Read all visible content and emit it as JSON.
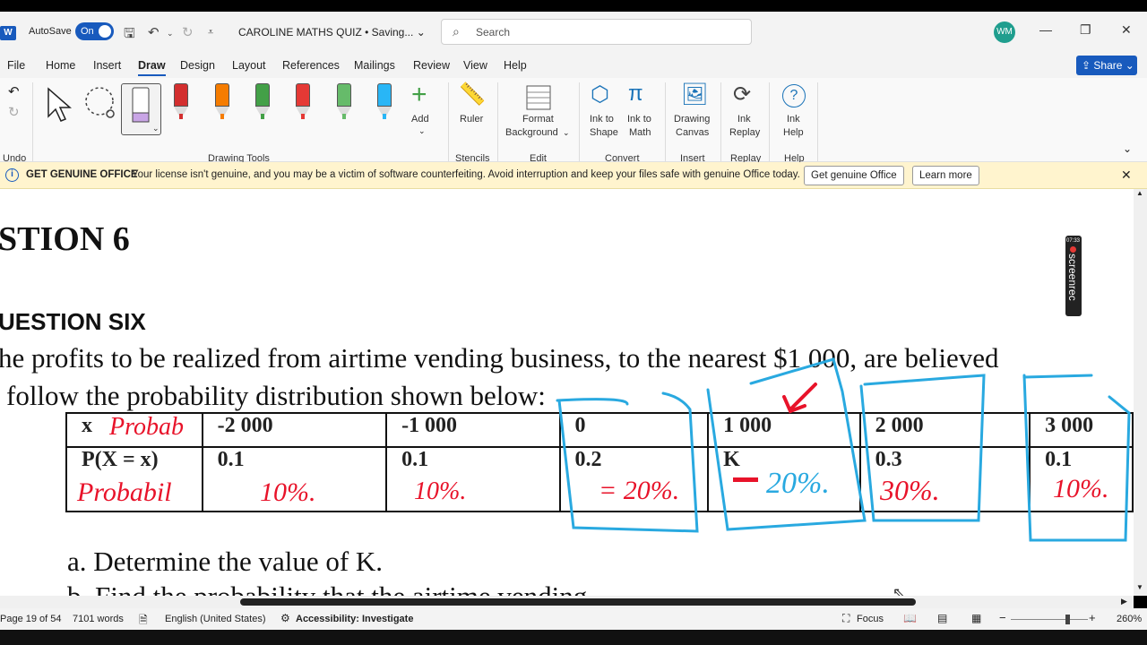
{
  "titlebar": {
    "app_icon": "W",
    "autosave_label": "AutoSave",
    "autosave_state": "On",
    "doc_title": "CAROLINE MATHS QUIZ • Saving...",
    "search_placeholder": "Search",
    "avatar_initials": "WM"
  },
  "menu": {
    "items": [
      "File",
      "Home",
      "Insert",
      "Draw",
      "Design",
      "Layout",
      "References",
      "Mailings",
      "Review",
      "View",
      "Help"
    ],
    "active": "Draw",
    "share_label": "Share"
  },
  "ribbon": {
    "groups": [
      "Undo",
      "Drawing Tools",
      "Stencils",
      "Edit",
      "Convert",
      "Insert",
      "Replay",
      "Help"
    ],
    "add_label": "Add",
    "ruler_label": "Ruler",
    "format_bg_line1": "Format",
    "format_bg_line2": "Background",
    "ink_shape_line1": "Ink to",
    "ink_shape_line2": "Shape",
    "ink_math_line1": "Ink to",
    "ink_math_line2": "Math",
    "canvas_line1": "Drawing",
    "canvas_line2": "Canvas",
    "replay_line1": "Ink",
    "replay_line2": "Replay",
    "help_line1": "Ink",
    "help_line2": "Help",
    "pen_colors": [
      "#d32f2f",
      "#f57c00",
      "#43a047",
      "#e53935",
      "#66bb6a",
      "#29b6f6"
    ]
  },
  "banner": {
    "title": "GET GENUINE OFFICE",
    "message": "Your license isn't genuine, and you may be a victim of software counterfeiting. Avoid interruption and keep your files safe with genuine Office today.",
    "btn_get": "Get genuine Office",
    "btn_learn": "Learn more"
  },
  "document": {
    "heading_partial": "STION 6",
    "subheading_partial": "UESTION SIX",
    "para_line1": "he profits to be realized from airtime vending business, to the nearest $1 000, are believed",
    "para_line2": "follow the probability distribution shown below:",
    "table": {
      "row1": [
        "x",
        "-2 000",
        "-1 000",
        "0",
        "1 000",
        "2 000",
        "3 000"
      ],
      "row2": [
        "P(X = x)",
        "0.1",
        "0.1",
        "0.2",
        "K",
        "0.3",
        "0.1"
      ]
    },
    "question_a": "a. Determine the value of K.",
    "question_b_partial": "b. Find the probability that the airtime vending"
  },
  "annotations": {
    "red_probab": "Probab",
    "red_probabil": "Probabil",
    "red_10a": "10%.",
    "red_10b": "10%.",
    "blue_20": "= 20%.",
    "blue_20b": "20%.",
    "blue_30": "30%.",
    "blue_10": "10%.",
    "ink_blue": "#29a9e0",
    "ink_red": "#e8132a"
  },
  "status": {
    "page": "Page 19 of 54",
    "words": "7101 words",
    "language": "English (United States)",
    "accessibility": "Accessibility: Investigate",
    "focus": "Focus",
    "zoom": "260%"
  },
  "screenrec": {
    "label": "screenrec",
    "time": "07:33"
  }
}
